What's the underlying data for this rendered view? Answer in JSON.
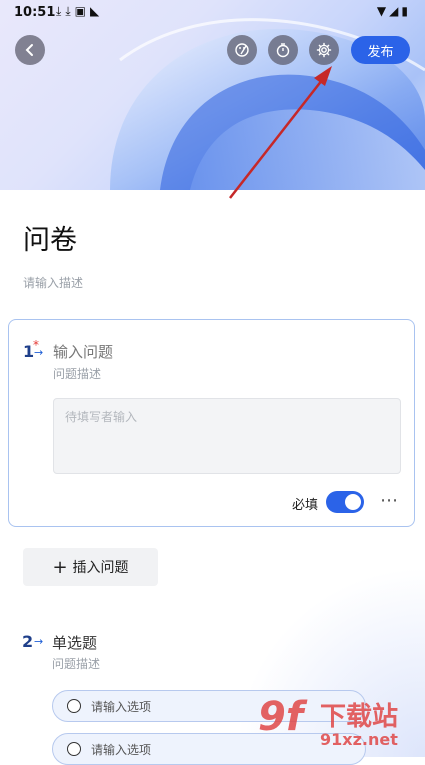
{
  "status_bar": {
    "time": "10:51",
    "left_icons": [
      "download-icon",
      "download-icon",
      "font-icon",
      "cast-icon"
    ],
    "right_icons": [
      "wifi-icon",
      "signal-icon",
      "battery-icon"
    ]
  },
  "toolbar": {
    "back_icon": "chevron-left-icon",
    "theme_icon": "palette-icon",
    "timer_icon": "timer-icon",
    "settings_icon": "gear-icon",
    "publish_label": "发布"
  },
  "form": {
    "title": "问卷",
    "description_placeholder": "请输入描述"
  },
  "questions": [
    {
      "number": "1",
      "required_mark": "*",
      "title_placeholder": "输入问题",
      "desc_placeholder": "问题描述",
      "answer_placeholder": "待填写者输入",
      "required_label": "必填",
      "required_on": true
    },
    {
      "number": "2",
      "title": "单选题",
      "desc_placeholder": "问题描述",
      "options": [
        "请输入选项",
        "请输入选项"
      ]
    }
  ],
  "insert_button": {
    "plus": "+",
    "label": "插入问题"
  },
  "watermark": {
    "logo": "9f",
    "text": "下载站",
    "url": "91xz.net"
  },
  "colors": {
    "accent": "#2b63e8",
    "annotation_arrow": "#c62828",
    "question_number": "#1f3f8a",
    "required_star": "#e53935"
  }
}
